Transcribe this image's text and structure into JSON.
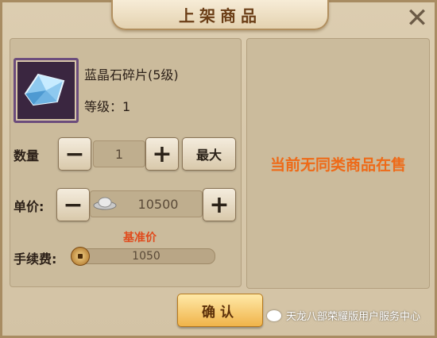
{
  "dialog": {
    "title": "上架商品",
    "close_icon": "close-icon"
  },
  "item": {
    "name": "蓝晶石碎片(5级)",
    "level_text": "等级：1",
    "icon": "blue-crystal-shard-icon"
  },
  "quantity": {
    "label": "数量",
    "value": "1",
    "minus": "−",
    "plus": "+",
    "max_label": "最大"
  },
  "price": {
    "label": "单价:",
    "value": "10500",
    "minus": "−",
    "plus": "+",
    "currency_icon": "silver-ingot-icon",
    "base_price_label": "基准价"
  },
  "fee": {
    "label": "手续费:",
    "value": "1050",
    "currency_icon": "copper-coin-icon"
  },
  "market": {
    "empty_text": "当前无同类商品在售"
  },
  "actions": {
    "confirm_label": "确认"
  },
  "watermark": {
    "text": "天龙八部荣耀版用户服务中心"
  },
  "colors": {
    "background": "#d8c9ac",
    "accent": "#ee6a18",
    "base_price": "#e04a1c",
    "confirm": "#f0b44a"
  }
}
